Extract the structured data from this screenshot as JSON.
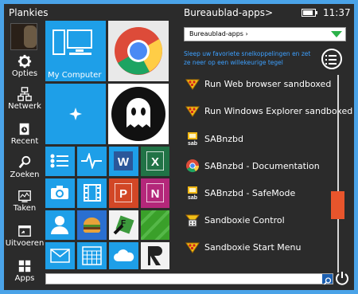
{
  "left": {
    "title": "Plankies",
    "nav": [
      {
        "label": "Opties",
        "icon": "gear-icon"
      },
      {
        "label": "Netwerk",
        "icon": "network-icon"
      },
      {
        "label": "Recent",
        "icon": "recent-icon"
      },
      {
        "label": "Zoeken",
        "icon": "search-icon"
      },
      {
        "label": "Taken",
        "icon": "tasks-icon"
      },
      {
        "label": "Uitvoeren",
        "icon": "run-icon"
      },
      {
        "label": "Apps",
        "icon": "apps-grid-icon"
      }
    ]
  },
  "tiles": {
    "my_computer_label": "My Computer"
  },
  "right": {
    "header": "Bureaublad-apps>",
    "clock": "11:37",
    "dropdown_value": "Bureaublad-apps ›",
    "hint": "Sleep uw favoriete snelkoppelingen en zet ze neer op een willekeurige tegel",
    "apps": [
      {
        "label": "Run Web browser sandboxed",
        "icon": "sandboxie-icon"
      },
      {
        "label": "Run Windows Explorer sandboxed",
        "icon": "sandboxie-icon"
      },
      {
        "label": "SABnzbd",
        "icon": "sabnzbd-icon"
      },
      {
        "label": "SABnzbd - Documentation",
        "icon": "chrome-icon"
      },
      {
        "label": "SABnzbd - SafeMode",
        "icon": "sabnzbd-icon"
      },
      {
        "label": "Sandboxie Control",
        "icon": "sandboxie-control-icon"
      },
      {
        "label": "Sandboxie Start Menu",
        "icon": "sandboxie-icon"
      }
    ],
    "scroll_position": 0.62
  },
  "search": {
    "value": ""
  },
  "colors": {
    "accent": "#1e9fe8",
    "scroll_thumb": "#e8552c",
    "hint": "#3da0ff"
  }
}
